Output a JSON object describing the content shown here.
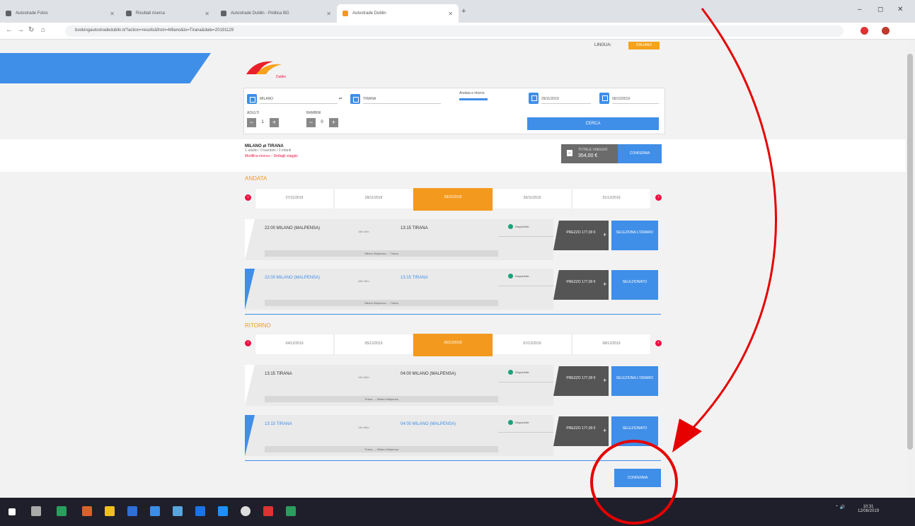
{
  "browser": {
    "tabs": [
      {
        "label": "Autostrade Fotos"
      },
      {
        "label": "Risultati ricerca"
      },
      {
        "label": "Autostrade Dublin - Politica BG"
      },
      {
        "label": "Autostrade Dublin"
      }
    ],
    "url": "bookingautostradedublin.it/?action=results&from=Milano&to=Tirana&date=20191129",
    "new_tab": "+",
    "controls": {
      "minimize": "–",
      "maximize": "◻",
      "close": "✕"
    }
  },
  "header": {
    "logo_sub": "Dublin",
    "language_label": "LINGUA:",
    "language_btn": "ITALIANO"
  },
  "search": {
    "from": "MILANO",
    "to": "TIRANA",
    "date1": "29/11/2019",
    "date2": "06/12/2019",
    "adults_label": "ADULTI",
    "children_label": "BAMBINI",
    "adults": "1",
    "children": "0",
    "trip_type": "Andata e ritorno",
    "search_btn": "CERCA"
  },
  "summary": {
    "title": "MILANO ⇄ TIRANA",
    "sub": "1 adulto / 0 bambini / 0 infanti",
    "link": "Modifica ricerca – Dettagli viaggio",
    "total_label": "TOTALE VIAGGIO",
    "total_value": "354,00 €",
    "minus": "–",
    "confirm": "CONFERMA"
  },
  "outbound": {
    "title": "ANDATA",
    "dates": [
      {
        "label": "27/11/2019"
      },
      {
        "label": "28/11/2019"
      },
      {
        "label": "29/11/2019"
      },
      {
        "label": "30/11/2019"
      },
      {
        "label": "01/12/2019"
      }
    ],
    "cards": [
      {
        "dep": "22:00 MILANO (MALPENSA)",
        "arr": "13:15 TIRANA",
        "dur": "15h 15m",
        "info": "Milano Malpensa → Tirana",
        "avail": "Disponibile",
        "price": "PREZZO 177,00 €",
        "select": "SELEZIONA L'ORARIO"
      },
      {
        "dep": "22:00 MILANO (MALPENSA)",
        "arr": "13:15 TIRANA",
        "dur": "15h 15m",
        "info": "Milano Malpensa → Tirana",
        "avail": "Disponibile",
        "price": "PREZZO 177,00 €",
        "select": "SELEZIONATO"
      }
    ]
  },
  "return": {
    "title": "RITORNO",
    "dates": [
      {
        "label": "04/12/2019"
      },
      {
        "label": "05/12/2019"
      },
      {
        "label": "06/12/2019"
      },
      {
        "label": "07/12/2019"
      },
      {
        "label": "08/12/2019"
      }
    ],
    "cards": [
      {
        "dep": "13:15 TIRANA",
        "arr": "04:00 MILANO (MALPENSA)",
        "dur": "14h 45m",
        "info": "Tirana → Milano Malpensa",
        "avail": "Disponibile",
        "price": "PREZZO 177,00 €",
        "select": "SELEZIONA L'ORARIO"
      },
      {
        "dep": "13:15 TIRANA",
        "arr": "04:00 MILANO (MALPENSA)",
        "dur": "14h 45m",
        "info": "Tirana → Milano Malpensa",
        "avail": "Disponibile",
        "price": "PREZZO 177,00 €",
        "select": "SELEZIONATO"
      }
    ]
  },
  "footer": {
    "confirm": "CONFERMA"
  },
  "taskbar": {
    "time": "10:31",
    "date": "12/08/2019",
    "tray": "⌃ 🔊"
  },
  "colors": {
    "accent": "#3f8ee8",
    "orange": "#f39a1e",
    "annotation": "#e60000"
  }
}
